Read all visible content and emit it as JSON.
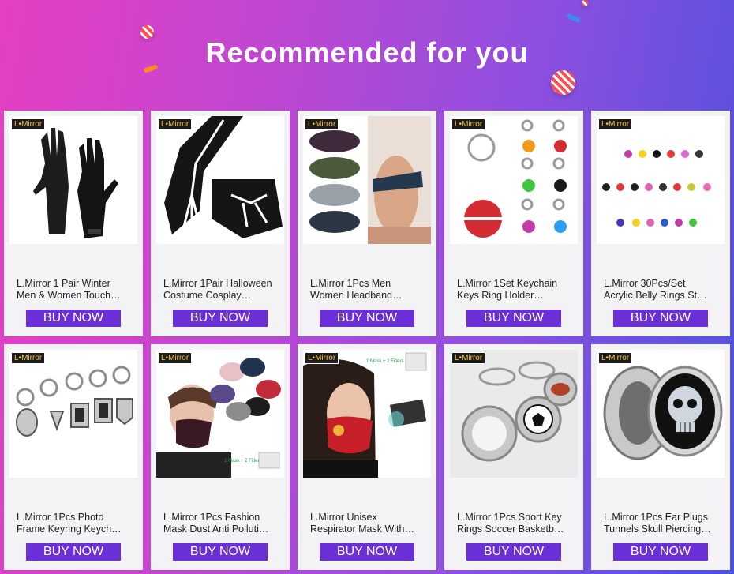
{
  "header": {
    "title": "Recommended for you"
  },
  "colors": {
    "buy_button": "#6a2fd6",
    "background_start": "#e63fc2",
    "background_end": "#4c52dc"
  },
  "brand_badge": "L•Mirror",
  "buy_label": "BUY NOW",
  "products": [
    {
      "line1": "L.Mirror 1 Pair Winter",
      "line2": "Men & Women Touch…",
      "image": "winter-gloves-image"
    },
    {
      "line1": "L.Mirror 1Pair Halloween",
      "line2": "Costume Cosplay…",
      "image": "skeleton-gloves-image"
    },
    {
      "line1": "L.Mirror 1Pcs Men",
      "line2": "Women Headband…",
      "image": "headbands-image"
    },
    {
      "line1": "L.Mirror 1Set Keychain",
      "line2": "Keys Ring Holder…",
      "image": "keychain-set-image"
    },
    {
      "line1": "L.Mirror 30Pcs/Set",
      "line2": "Acrylic Belly Rings St…",
      "image": "belly-rings-image"
    },
    {
      "line1": "L.Mirror 1Pcs Photo",
      "line2": "Frame Keyring Keych…",
      "image": "photo-keyrings-image"
    },
    {
      "line1": "L.Mirror 1Pcs Fashion",
      "line2": "Mask Dust Anti Polluti…",
      "image": "fashion-mask-image"
    },
    {
      "line1": "L.Mirror Unisex",
      "line2": "Respirator Mask With…",
      "image": "respirator-mask-image"
    },
    {
      "line1": "L.Mirror 1Pcs Sport Key",
      "line2": "Rings Soccer Basketb…",
      "image": "sport-keyrings-image"
    },
    {
      "line1": "L.Mirror 1Pcs Ear Plugs",
      "line2": "Tunnels Skull Piercing…",
      "image": "skull-ear-plugs-image"
    }
  ],
  "image_texts": {
    "mask_filters": "1 Mask + 2 Filters"
  }
}
